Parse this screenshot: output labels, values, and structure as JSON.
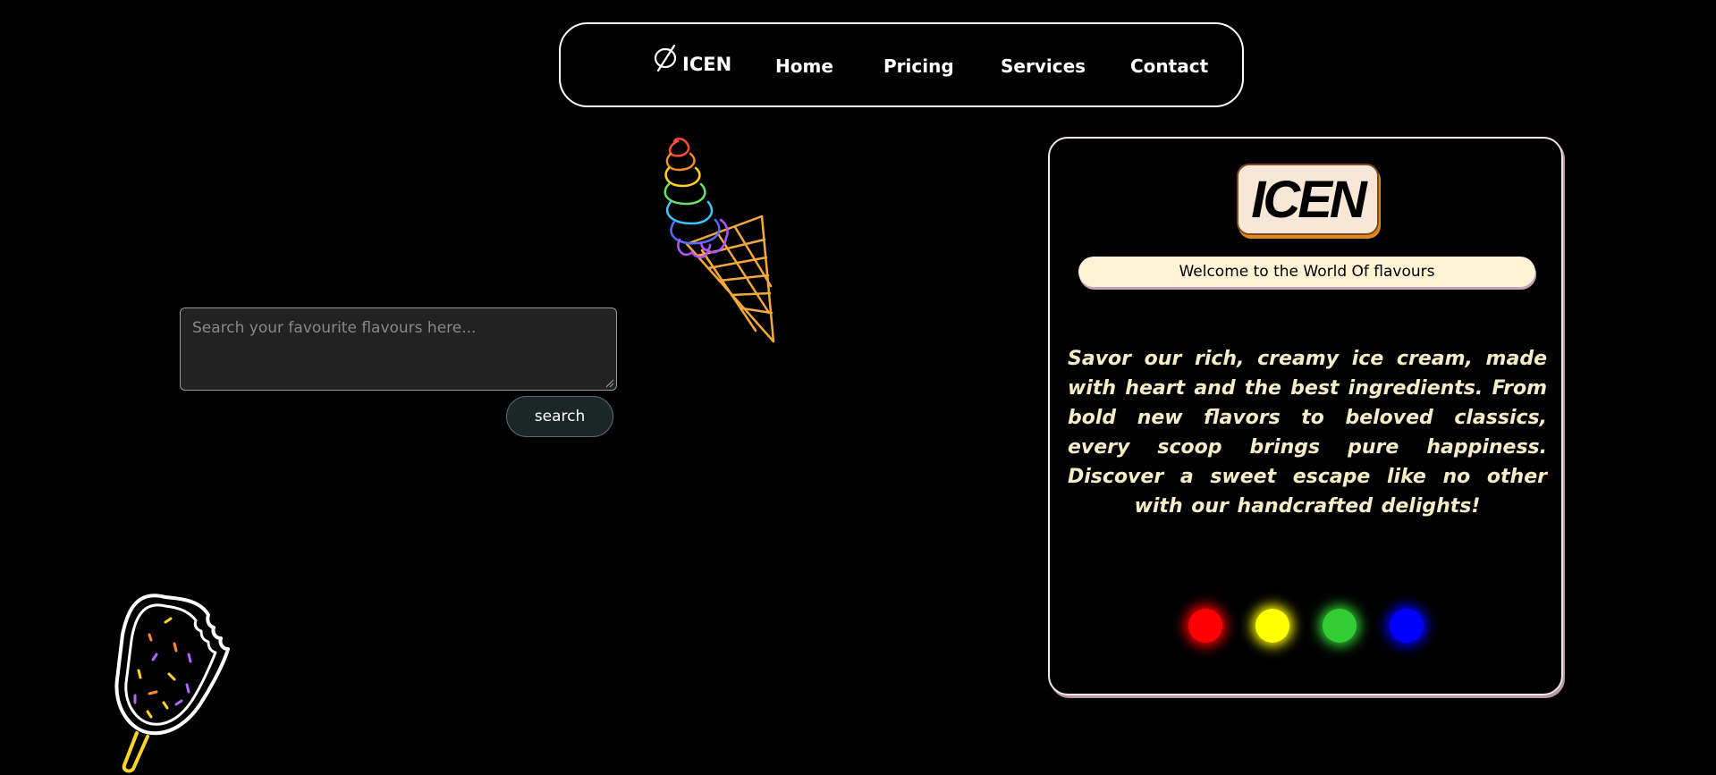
{
  "navbar": {
    "brand_text": "ICEN",
    "brand_icon": "ice-cream-slash-icon",
    "links": [
      {
        "label": "Home"
      },
      {
        "label": "Pricing"
      },
      {
        "label": "Services"
      },
      {
        "label": "Contact"
      }
    ]
  },
  "search": {
    "placeholder": "Search your favourite flavours here...",
    "value": "",
    "button_label": "search"
  },
  "decorations": {
    "cone": "rainbow-soft-serve-cone-icon",
    "popsicle": "sprinkled-popsicle-icon"
  },
  "card": {
    "logo_text": "ICEN",
    "welcome_text": "Welcome to the World Of flavours",
    "paragraph": "Savor our rich, creamy ice cream, made with heart and the best ingredients. From bold new flavors to beloved classics, every scoop brings pure happiness. Discover a sweet escape like no other with our handcrafted delights!",
    "color_dots": [
      {
        "name": "red",
        "color": "#ff0000"
      },
      {
        "name": "yellow",
        "color": "#ffff00"
      },
      {
        "name": "green",
        "color": "#33cc33"
      },
      {
        "name": "blue",
        "color": "#0000ff"
      }
    ]
  },
  "colors": {
    "background": "#000000",
    "accent_cream": "#fff3d6",
    "accent_orange": "#e1861a",
    "text_cream": "#f5ecc8"
  }
}
